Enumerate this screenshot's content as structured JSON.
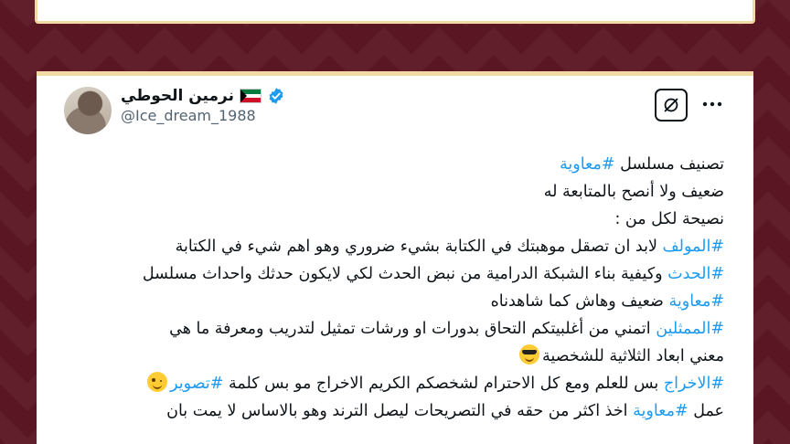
{
  "user": {
    "display_name": "نرمين الحوطي",
    "handle": "@Ice_dream_1988",
    "flag": "kuwait-flag-icon",
    "verified": true
  },
  "icons": {
    "grok": "grok-icon",
    "more": "more-horizontal-icon"
  },
  "colors": {
    "background": "#5a1622",
    "card_border": "#f3d9a6",
    "hashtag": "#1d9bf0",
    "verified": "#1d9bf0",
    "text": "#0f1419",
    "handle": "#536471"
  },
  "tweet": {
    "l1": {
      "text": "تصنيف مسلسل ",
      "tag": "#معاوية"
    },
    "l2": {
      "text": "ضعيف ولا أنصح بالمتابعة له"
    },
    "l3": {
      "text": "نصيحة لكل من :"
    },
    "l4": {
      "tag": "#المولف",
      "text": " لابد ان تصقل موهبتك في الكتابة بشيء ضروري وهو اهم شيء في الكتابة"
    },
    "l5": {
      "tag": "#الحدث",
      "text": " وكيفية بناء الشبكة الدرامية من نبض الحدث لكي لايكون حدثك واحداث مسلسل"
    },
    "l6": {
      "tag": "#معاوية",
      "text": " ضعيف وهاش كما شاهدناه"
    },
    "l7": {
      "tag": "#الممثلين",
      "text": " اتمني من أغلبيتكم التحاق بدورات او ورشات تمثيل لتدريب ومعرفة ما هي"
    },
    "l8": {
      "text": "معني ابعاد الثلاثية للشخصية",
      "emoji": "sunglasses-emoji"
    },
    "l9": {
      "tag": "#الاخراج",
      "text": " بس للعلم ومع كل الاحترام لشخصكم الكريم الاخراج مو بس كلمة ",
      "tag2": "#تصوير",
      "emoji": "winking-emoji"
    },
    "l10": {
      "text_a": "عمل ",
      "tag": "#معاوية",
      "text_b": " اخذ اكثر من حقه في التصريحات ليصل الترند وهو بالاساس لا يمت بان"
    }
  }
}
